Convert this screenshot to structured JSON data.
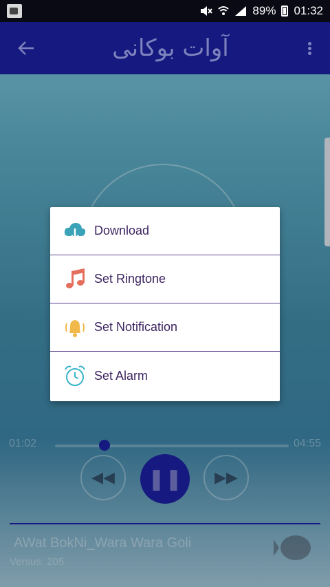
{
  "status_bar": {
    "battery": "89%",
    "time": "01:32"
  },
  "app_bar": {
    "title": "آوات بوکانی"
  },
  "menu": {
    "items": [
      {
        "label": "Download",
        "icon": "cloud-download-icon"
      },
      {
        "label": "Set Ringtone",
        "icon": "music-note-icon"
      },
      {
        "label": "Set Notification",
        "icon": "bell-icon"
      },
      {
        "label": "Set Alarm",
        "icon": "alarm-clock-icon"
      }
    ]
  },
  "player": {
    "elapsed": "01:02",
    "duration": "04:55",
    "track_title": "AWat BokNi_Wara Wara Goli",
    "version_label": "Versus: 205"
  },
  "colors": {
    "app_bar": "#1b1f9c",
    "menu_text": "#3d2460",
    "divider": "#5a3e8f"
  }
}
